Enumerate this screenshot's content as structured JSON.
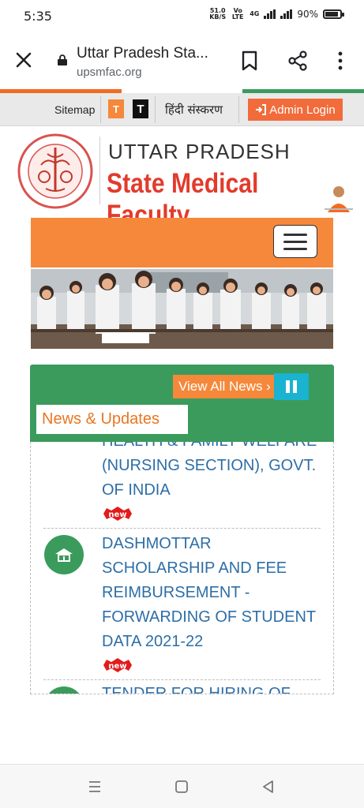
{
  "status_bar": {
    "time": "5:35",
    "net_speed": "51.0",
    "net_unit": "KB/S",
    "volte": "Vo LTE",
    "network": "4G",
    "battery": "90%",
    "battery_level": 0.9
  },
  "browser": {
    "title": "Uttar Pradesh Sta...",
    "url": "upsmfac.org"
  },
  "tricolor": [
    "#f26b23",
    "#ffffff",
    "#3b9b5c"
  ],
  "topbar": {
    "sitemap": "Sitemap",
    "t_small": "T",
    "t_large": "T",
    "hindi": "हिंदी संस्करण",
    "admin_login": "Admin Login"
  },
  "header": {
    "line1": "UTTAR PRADESH",
    "line2": "State Medical Faculty"
  },
  "news": {
    "view_all": "View All News ›",
    "label": "News & Updates",
    "items": [
      {
        "text": "HEALTH & FAMILY WELFARE (NURSING SECTION), GOVT. OF INDIA",
        "badge": "new"
      },
      {
        "text": "DASHMOTTAR SCHOLARSHIP AND FEE REIMBURSEMENT - FORWARDING OF STUDENT DATA 2021-22",
        "badge": "new"
      },
      {
        "text": "TENDER FOR HIRING OF",
        "badge": ""
      }
    ]
  },
  "colors": {
    "orange": "#f5883a",
    "green": "#3b9b5c",
    "red": "#e23b2c",
    "link_blue": "#2e6ea6",
    "cyan": "#1ab3d0"
  }
}
